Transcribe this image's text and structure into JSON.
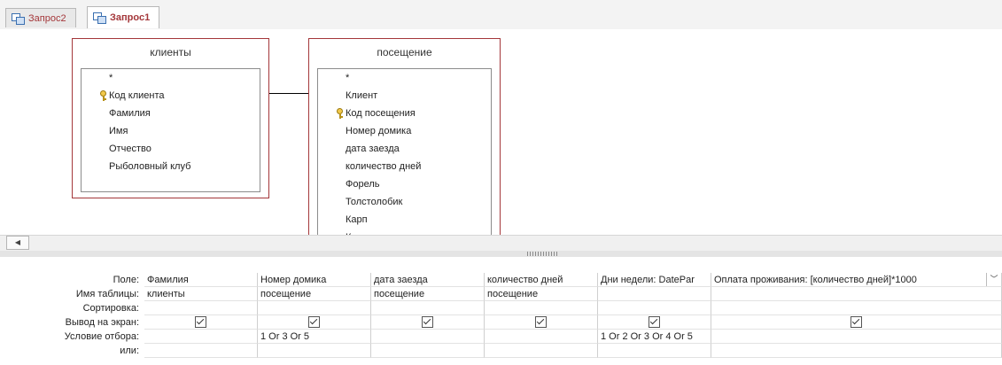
{
  "tabs": [
    {
      "label": "Запрос2",
      "active": false
    },
    {
      "label": "Запрос1",
      "active": true
    }
  ],
  "tables": [
    {
      "name": "клиенты",
      "fields": [
        {
          "label": "*",
          "key": false
        },
        {
          "label": "Код клиента",
          "key": true
        },
        {
          "label": "Фамилия",
          "key": false
        },
        {
          "label": "Имя",
          "key": false
        },
        {
          "label": "Отчество",
          "key": false
        },
        {
          "label": "Рыболовный клуб",
          "key": false
        }
      ]
    },
    {
      "name": "посещение",
      "fields": [
        {
          "label": "*",
          "key": false
        },
        {
          "label": "Клиент",
          "key": false
        },
        {
          "label": "Код посещения",
          "key": true
        },
        {
          "label": "Номер домика",
          "key": false
        },
        {
          "label": "дата заезда",
          "key": false
        },
        {
          "label": "количество дней",
          "key": false
        },
        {
          "label": "Форель",
          "key": false
        },
        {
          "label": "Толстолобик",
          "key": false
        },
        {
          "label": "Карп",
          "key": false
        },
        {
          "label": "К",
          "key": false
        }
      ]
    }
  ],
  "grid": {
    "row_labels": [
      "Поле:",
      "Имя таблицы:",
      "Сортировка:",
      "Вывод на экран:",
      "Условие отбора:",
      "или:"
    ],
    "columns": [
      {
        "field": "Фамилия",
        "table": "клиенты",
        "sort": "",
        "show": true,
        "criteria": "",
        "or": ""
      },
      {
        "field": "Номер домика",
        "table": "посещение",
        "sort": "",
        "show": true,
        "criteria": "1 Or 3 Or 5",
        "or": ""
      },
      {
        "field": "дата заезда",
        "table": "посещение",
        "sort": "",
        "show": true,
        "criteria": "",
        "or": ""
      },
      {
        "field": "количество дней",
        "table": "посещение",
        "sort": "",
        "show": true,
        "criteria": "",
        "or": ""
      },
      {
        "field": "Дни недели: DatePar",
        "table": "",
        "sort": "",
        "show": true,
        "criteria": "1 Or 2 Or 3 Or 4 Or 5",
        "or": ""
      },
      {
        "field": "Оплата проживания: [количество дней]*1000",
        "table": "",
        "sort": "",
        "show": true,
        "criteria": "",
        "or": ""
      }
    ]
  },
  "icons": {
    "tab": "query-icon",
    "key": "primary-key-icon",
    "scroll_left": "scroll-left-arrow-icon",
    "dropdown": "chevron-down-icon"
  },
  "colors": {
    "table_border": "#a4373a",
    "tab_text": "#a4373a"
  }
}
